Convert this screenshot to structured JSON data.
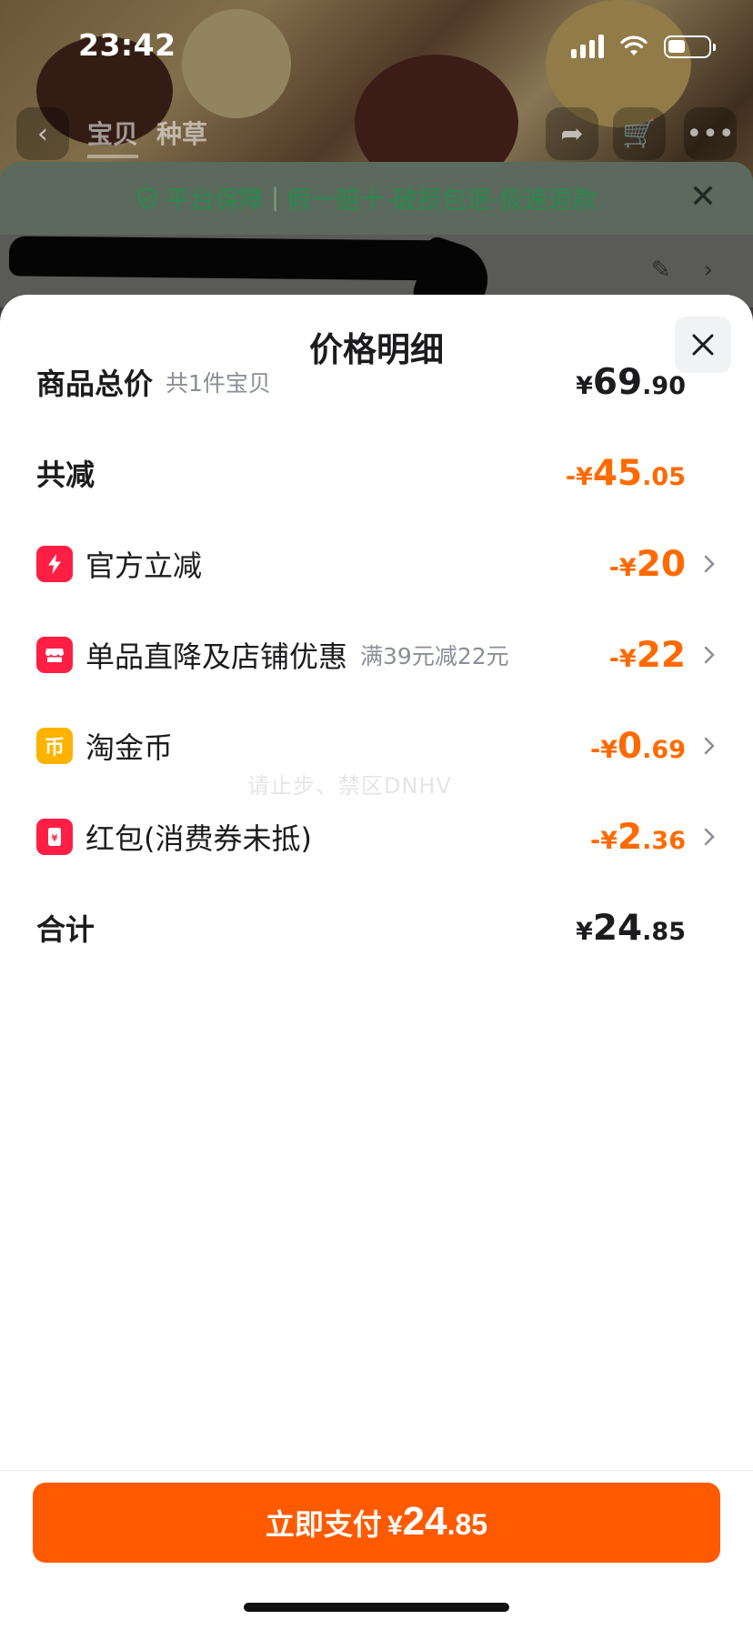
{
  "status_bar": {
    "time": "23:42"
  },
  "background": {
    "tabs": [
      "宝贝",
      "种草"
    ],
    "guarantee": {
      "prefix": "平台保障",
      "text": "假一赔十·破损包退·极速退款"
    }
  },
  "sheet": {
    "title": "价格明细",
    "rows": [
      {
        "label": "商品总价",
        "sub": "共1件宝贝",
        "currency": "¥",
        "int": "69",
        "dec": ".90"
      },
      {
        "label": "共减",
        "currency": "-¥",
        "int": "45",
        "dec": ".05"
      },
      {
        "label": "官方立减",
        "currency": "-¥",
        "int": "20",
        "dec": ""
      },
      {
        "label": "单品直降及店铺优惠",
        "sub": "满39元减22元",
        "currency": "-¥",
        "int": "22",
        "dec": ""
      },
      {
        "label": "淘金币",
        "icon_char": "币",
        "currency": "-¥",
        "int": "0",
        "dec": ".69"
      },
      {
        "label": "红包(消费券未抵)",
        "currency": "-¥",
        "int": "2",
        "dec": ".36"
      },
      {
        "label": "合计",
        "currency": "¥",
        "int": "24",
        "dec": ".85"
      }
    ],
    "watermark": "请止步、禁区DNHV"
  },
  "pay_button": {
    "label": "立即支付",
    "currency": "¥",
    "int": "24",
    "dec": ".85"
  },
  "colors": {
    "accent": "#ff6a00",
    "pay_button": "#ff5a00",
    "icon_red": "#ff1f45",
    "icon_yellow": "#ffb300"
  },
  "icons": [
    "lightning-icon",
    "shop-icon",
    "coin-icon",
    "red-packet-icon",
    "chevron-right-icon",
    "close-icon"
  ]
}
